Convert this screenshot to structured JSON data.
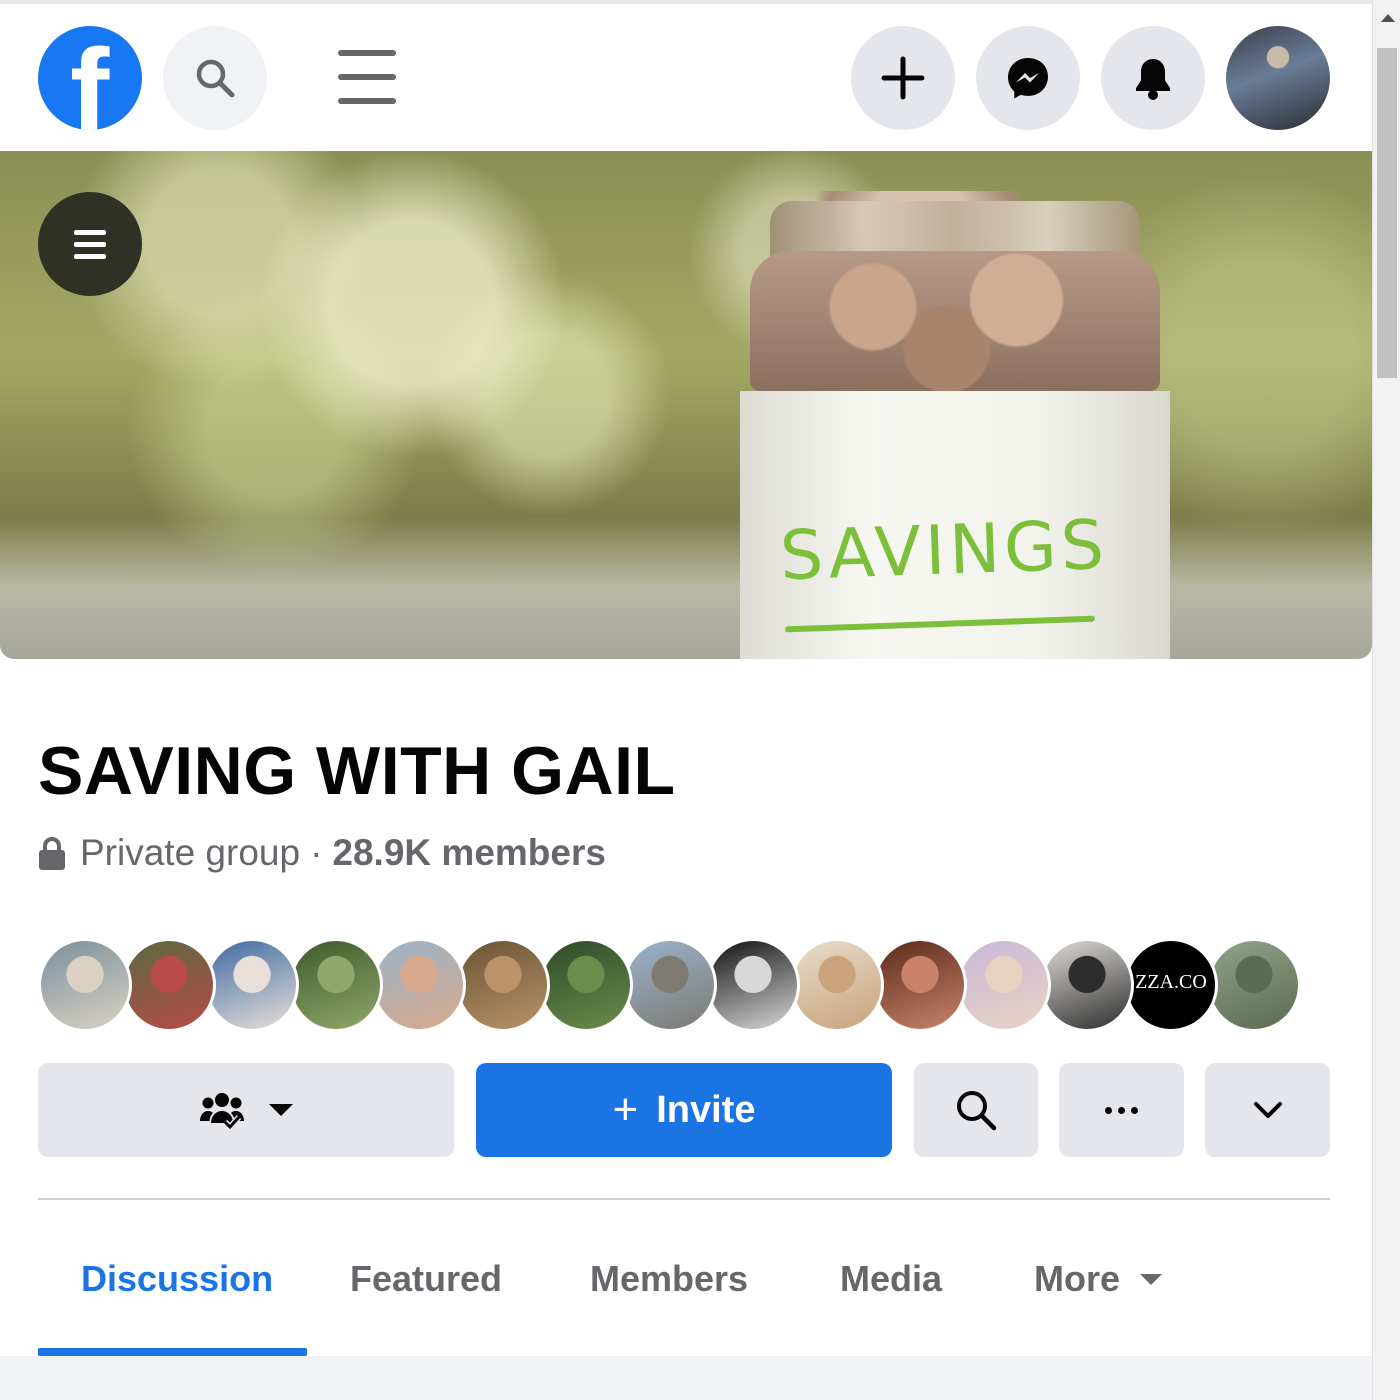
{
  "header": {
    "logo_letter": "f",
    "icons": [
      "facebook-logo",
      "search-icon",
      "menu-icon",
      "plus-icon",
      "messenger-icon",
      "bell-icon"
    ]
  },
  "cover": {
    "jar_label": "SAVINGS"
  },
  "group": {
    "name": "SAVING WITH GAIL",
    "privacy": "Private group",
    "separator": "·",
    "members": "28.9K members"
  },
  "member_avatars": [
    {
      "colors": [
        "#7b8f9e",
        "#d9d2c3"
      ]
    },
    {
      "colors": [
        "#5a6a40",
        "#b84a4a"
      ]
    },
    {
      "colors": [
        "#3f6aa3",
        "#e8e0d8"
      ]
    },
    {
      "colors": [
        "#3d5a2a",
        "#8fa86a"
      ]
    },
    {
      "colors": [
        "#9ab3c9",
        "#d8a88a"
      ]
    },
    {
      "colors": [
        "#6b5236",
        "#b89468"
      ]
    },
    {
      "colors": [
        "#2e4a2a",
        "#6b8c4a"
      ]
    },
    {
      "colors": [
        "#9ab3cc",
        "#7d7a72"
      ]
    },
    {
      "colors": [
        "#111111",
        "#d8d8d8"
      ]
    },
    {
      "colors": [
        "#e8dccc",
        "#c9a37a"
      ]
    },
    {
      "colors": [
        "#5a2a1a",
        "#c9836a"
      ]
    },
    {
      "colors": [
        "#c9b8d9",
        "#e8d3c3"
      ]
    },
    {
      "colors": [
        "#e0ddd8",
        "#2d2d2d"
      ]
    },
    {
      "colors": [
        "#000000",
        "#000000"
      ],
      "text": "ZZA.CO"
    },
    {
      "colors": [
        "#8fa38a",
        "#5d6a52"
      ]
    }
  ],
  "actions": {
    "invite_label": "Invite",
    "invite_plus": "+"
  },
  "tabs": {
    "discussion": "Discussion",
    "featured": "Featured",
    "members": "Members",
    "media": "Media",
    "more": "More"
  },
  "colors": {
    "brand_blue": "#1877f2",
    "primary_button": "#1b74e4",
    "secondary_text": "#65676b",
    "button_grey": "#e4e6eb"
  }
}
